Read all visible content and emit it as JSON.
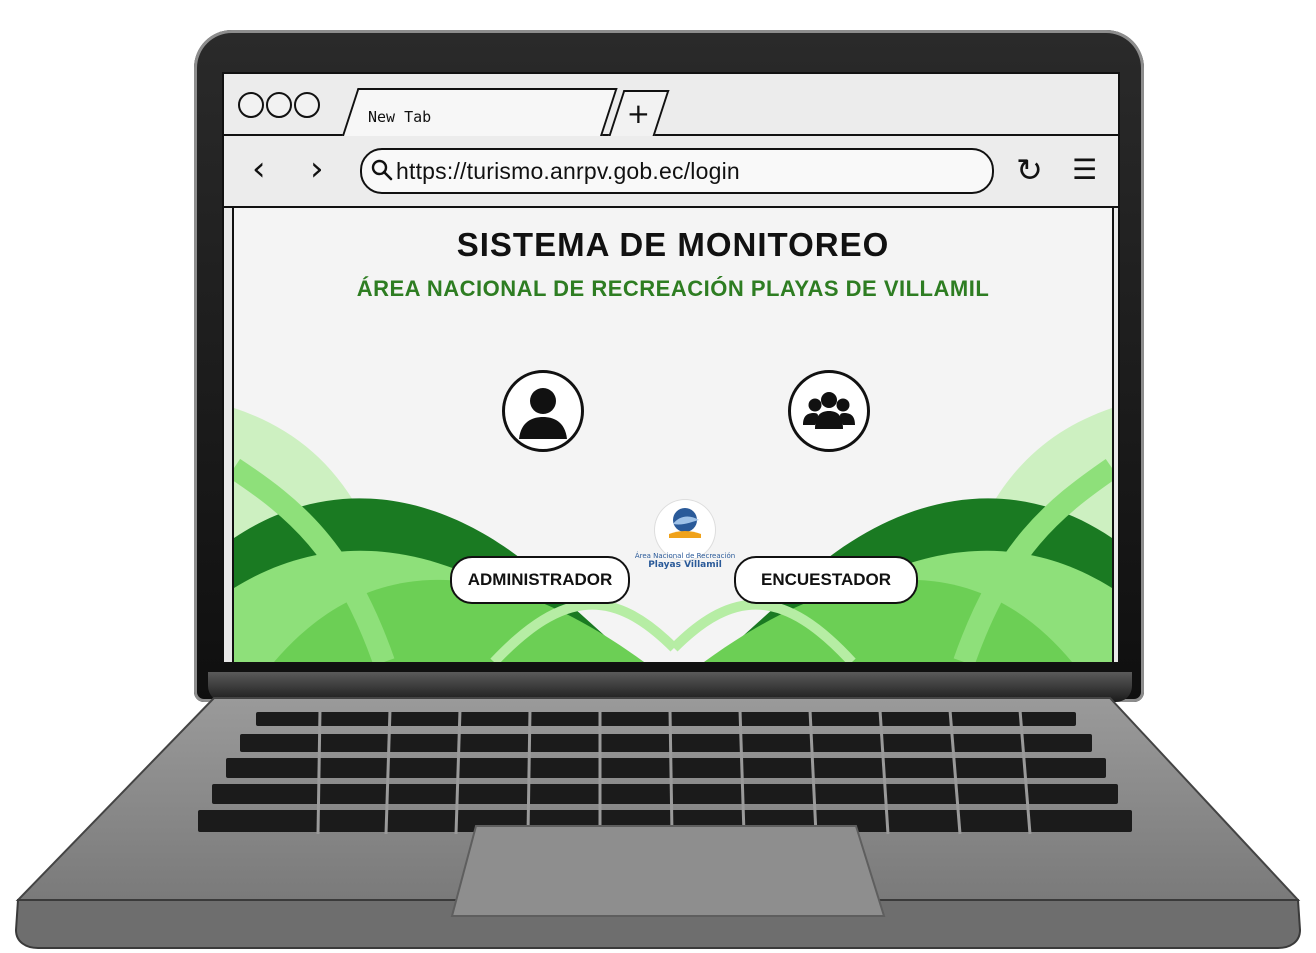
{
  "browser": {
    "tab_title": "New Tab",
    "new_tab_symbol": "+",
    "back_symbol": "‹",
    "forward_symbol": "›",
    "url": "https://turismo.anrpv.gob.ec/login",
    "reload_symbol": "↻",
    "menu_symbol": "☰"
  },
  "page": {
    "title": "SISTEMA DE MONITOREO",
    "subtitle": "ÁREA NACIONAL DE RECREACIÓN PLAYAS DE VILLAMIL",
    "roles": [
      {
        "label": "ADMINISTRADOR",
        "icon": "user-icon"
      },
      {
        "label": "ENCUESTADOR",
        "icon": "users-group-icon"
      }
    ],
    "logo": {
      "line1": "Área Nacional de Recreación",
      "line2": "Playas Villamil"
    }
  },
  "colors": {
    "accent_green": "#2e7d22",
    "light_green": "#8ee07a",
    "dark_green": "#1a7a22"
  }
}
